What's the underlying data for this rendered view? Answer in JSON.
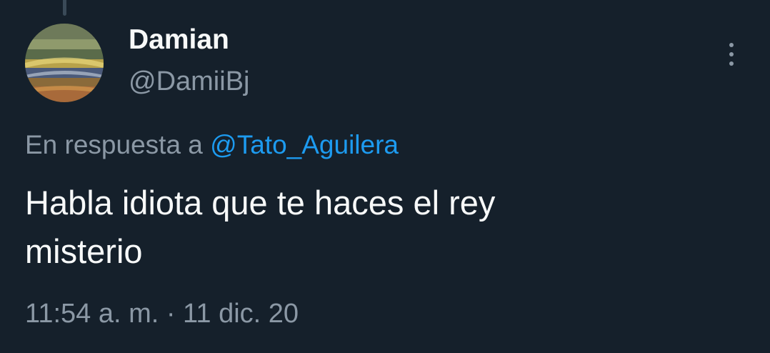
{
  "tweet": {
    "author": {
      "display_name": "Damian",
      "handle": "@DamiiBj",
      "avatar_icon": "stadium-crowd-avatar"
    },
    "more_icon": "vertical-ellipsis-icon",
    "reply": {
      "prefix": "En respuesta a ",
      "target": "@Tato_Aguilera"
    },
    "text_lines": [
      "Habla idiota que te haces el rey",
      "misterio"
    ],
    "timestamp": "11:54 a. m. · 11 dic. 20"
  },
  "colors": {
    "background": "#15202b",
    "primary_text": "#f7f9f9",
    "secondary_text": "#8b98a5",
    "link": "#1d9bf0"
  }
}
